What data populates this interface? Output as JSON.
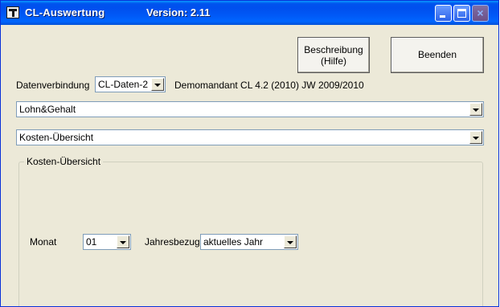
{
  "window": {
    "title": "CL-Auswertung",
    "version": "Version: 2.11",
    "controls": {
      "minimize": "minimize",
      "maximize": "maximize",
      "close": "×"
    }
  },
  "toolbar": {
    "help_label_line1": "Beschreibung",
    "help_label_line2": "(Hilfe)",
    "end_label": "Beenden"
  },
  "connection": {
    "label": "Datenverbindung",
    "selected": "CL-Daten-2",
    "info": "Demomandant CL 4.2 (2010) JW 2009/2010"
  },
  "module_select": {
    "selected": "Lohn&Gehalt"
  },
  "report_select": {
    "selected": "Kosten-Übersicht"
  },
  "group": {
    "title": "Kosten-Übersicht",
    "month_label": "Monat",
    "month_value": "01",
    "year_label": "Jahresbezug",
    "year_value": "aktuelles Jahr"
  },
  "colors": {
    "title_bar": "#0054e3",
    "window_bg": "#ece9d8",
    "input_border": "#7f9db9"
  }
}
